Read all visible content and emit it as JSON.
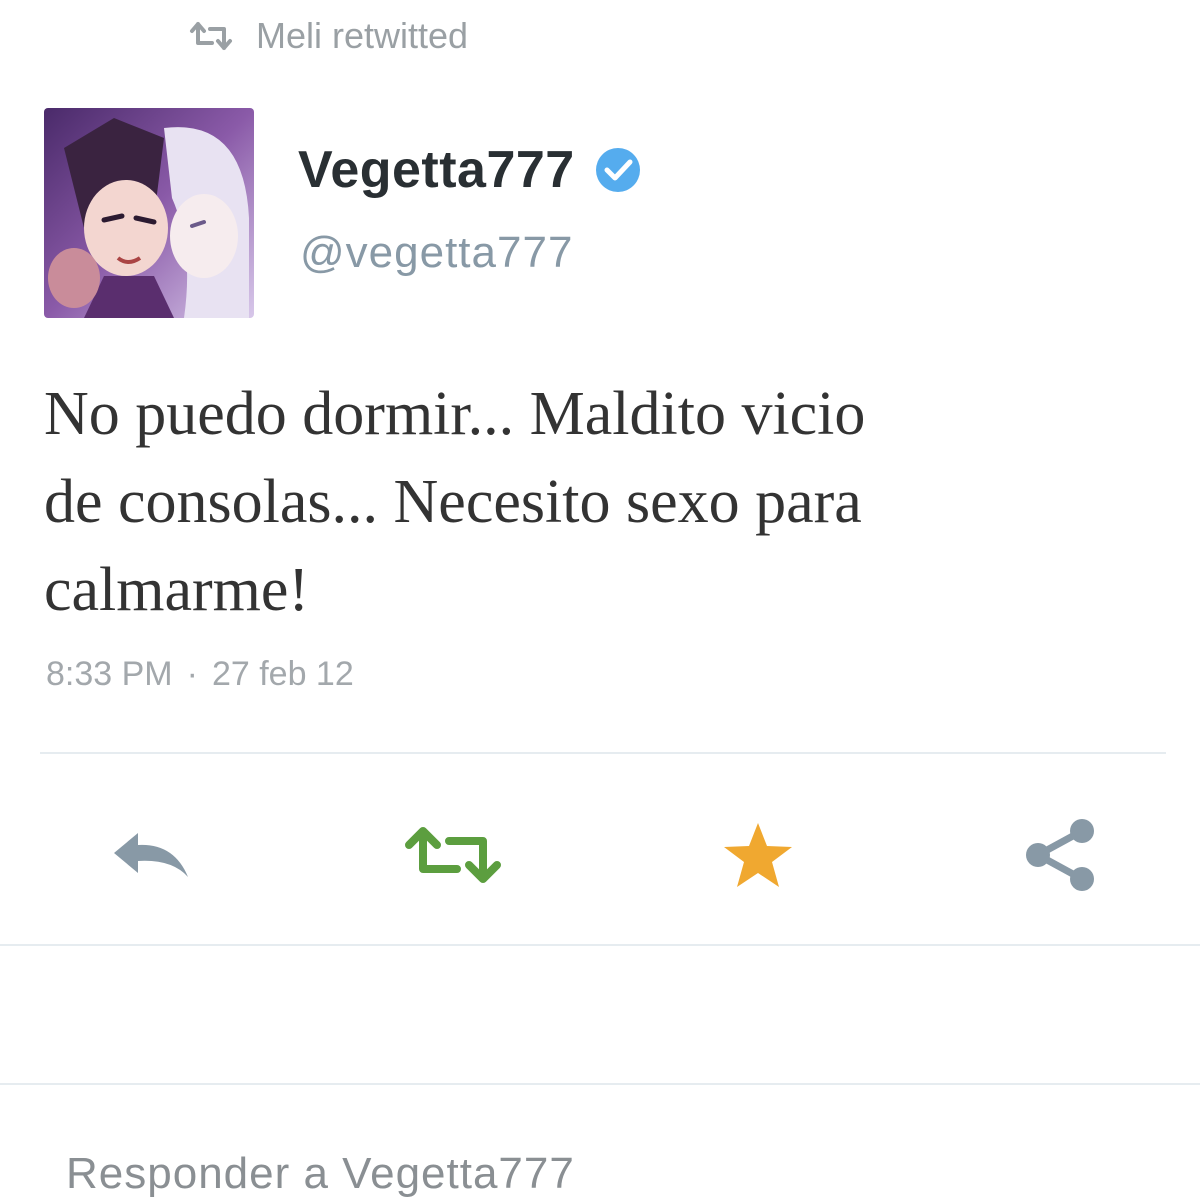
{
  "context": {
    "retweet_label": "Meli retwitted",
    "retweet_icon": "retweet-icon"
  },
  "author": {
    "display_name": "Vegetta777",
    "handle": "@vegetta777",
    "verified": true,
    "verified_icon": "verified-badge-icon"
  },
  "tweet": {
    "text": "No puedo dormir... Maldito vicio\nde consolas... Necesito sexo para\ncalmarme!",
    "time": "8:33 PM",
    "date": "27 feb 12"
  },
  "actions": [
    {
      "name": "reply",
      "icon": "reply-icon",
      "color": "#8899a6"
    },
    {
      "name": "retweet",
      "icon": "retweet-icon",
      "color": "#5c9e3f",
      "active": true
    },
    {
      "name": "favorite",
      "icon": "star-icon",
      "color": "#f0a830",
      "active": true
    },
    {
      "name": "share",
      "icon": "share-icon",
      "color": "#8899a6"
    }
  ],
  "reply_box": {
    "placeholder": "Responder a Vegetta777"
  },
  "colors": {
    "verified_blue": "#55acee",
    "divider": "#e6ecf0",
    "muted_text": "#8899a6"
  }
}
